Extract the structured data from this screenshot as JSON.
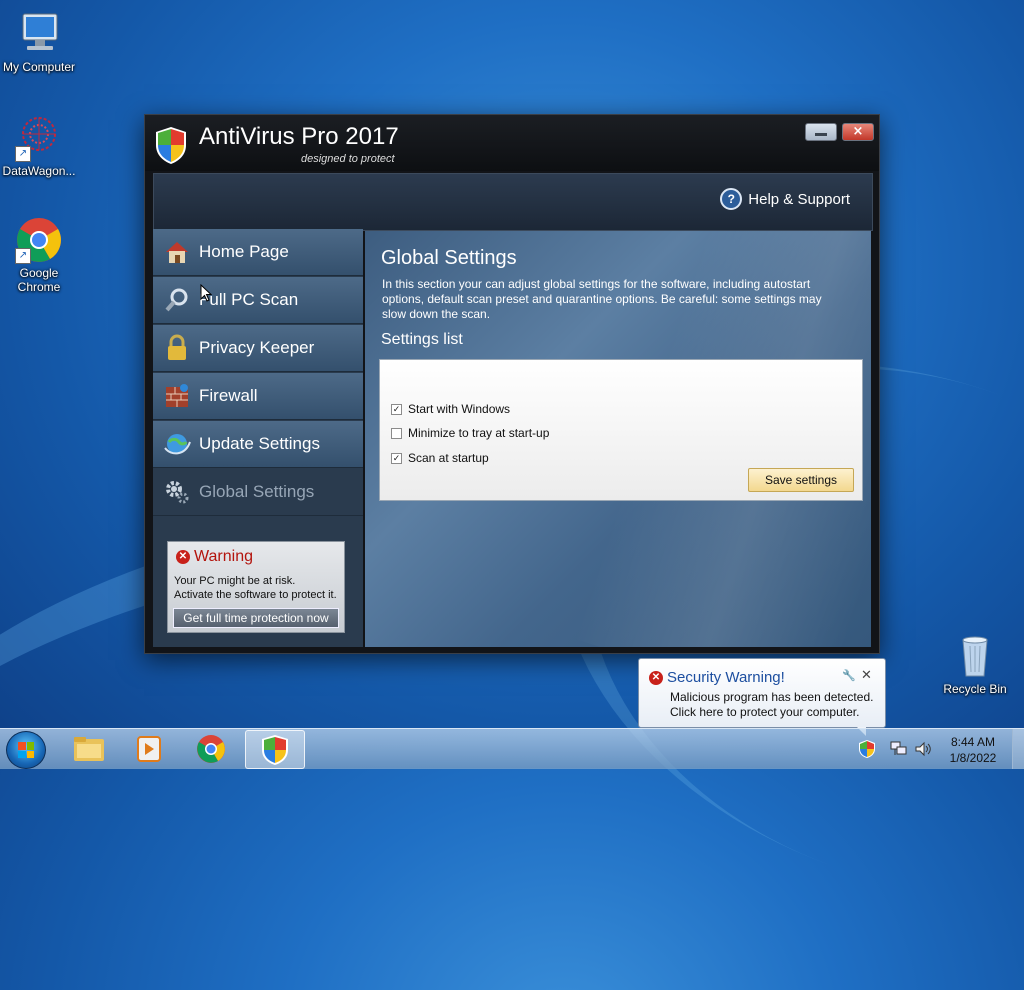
{
  "desktop": {
    "icons": [
      {
        "label": "My Computer"
      },
      {
        "label": "DataWagon..."
      },
      {
        "label": "Google Chrome"
      },
      {
        "label": "Recycle Bin"
      }
    ]
  },
  "window": {
    "title": "AntiVirus Pro 2017",
    "tagline": "designed to protect",
    "close_glyph": "×",
    "help_label": "Help & Support",
    "help_glyph": "?"
  },
  "sidebar": {
    "items": [
      {
        "label": "Home Page",
        "icon": "house-icon"
      },
      {
        "label": "Full PC Scan",
        "icon": "magnifier-icon"
      },
      {
        "label": "Privacy Keeper",
        "icon": "padlock-icon"
      },
      {
        "label": "Firewall",
        "icon": "brick-wall-icon"
      },
      {
        "label": "Update Settings",
        "icon": "globe-update-icon"
      },
      {
        "label": "Global Settings",
        "icon": "gears-icon",
        "active": true
      }
    ],
    "warning": {
      "title": "Warning",
      "line1": "Your PC might be at risk.",
      "line2": "Activate the software to protect it.",
      "button": "Get full time protection now"
    }
  },
  "content": {
    "title": "Global Settings",
    "description": "In this section your can adjust global settings for the software, including autostart options, default scan preset and quarantine options. Be careful: some settings may slow down the scan.",
    "settings_heading": "Settings list",
    "options": [
      {
        "label": "Start with Windows",
        "checked": true
      },
      {
        "label": "Minimize to tray at start-up",
        "checked": false
      },
      {
        "label": "Scan at startup",
        "checked": true
      }
    ],
    "check_glyph": "✓",
    "save_label": "Save settings"
  },
  "notification": {
    "title": "Security Warning!",
    "line1": "Malicious program has been detected.",
    "line2": "Click here to protect your computer.",
    "pin_glyph": "🔧",
    "close_glyph": "✕",
    "error_glyph": "✕"
  },
  "taskbar": {
    "time": "8:44 AM",
    "date": "1/8/2022"
  },
  "colors": {
    "warning_red": "#b3140d",
    "balloon_title": "#1d4fa0",
    "save_button": "#f3d88f"
  }
}
